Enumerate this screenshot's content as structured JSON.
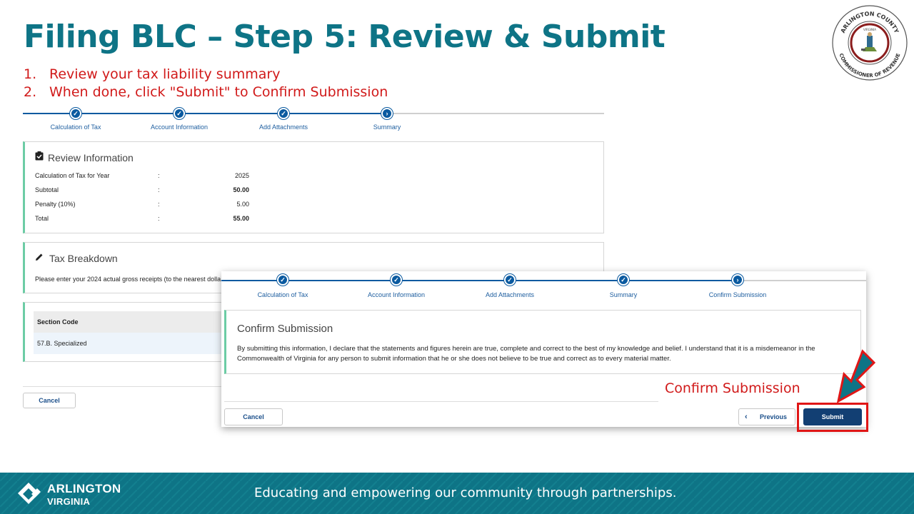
{
  "slide": {
    "title": "Filing BLC – Step 5:  Review & Submit",
    "instructions": [
      {
        "num": "1.",
        "text": "Review your tax liability summary"
      },
      {
        "num": "2.",
        "text": "When done, click \"Submit\" to Confirm Submission"
      }
    ],
    "callout": "Confirm Submission",
    "seal": {
      "top_text": "ARLINGTON COUNTY",
      "bottom_text": "COMMISSIONER OF REVENUE",
      "inner_text": "VIRGINIA"
    }
  },
  "background_stepper": {
    "steps": [
      {
        "label": "Calculation of Tax",
        "icon": "check-icon"
      },
      {
        "label": "Account Information",
        "icon": "check-icon"
      },
      {
        "label": "Add Attachments",
        "icon": "check-icon"
      },
      {
        "label": "Summary",
        "icon": "chevron-right-icon"
      }
    ]
  },
  "review": {
    "title": "Review Information",
    "rows": [
      {
        "label": "Calculation of Tax for Year",
        "sep": ":",
        "value": "2025"
      },
      {
        "label": "Subtotal",
        "sep": ":",
        "value": "50.00"
      },
      {
        "label": "Penalty (10%)",
        "sep": ":",
        "value": "5.00"
      },
      {
        "label": "Total",
        "sep": ":",
        "value": "55.00"
      }
    ]
  },
  "breakdown": {
    "title": "Tax Breakdown",
    "text": "Please enter your 2024 actual gross receipts (to the nearest dolla",
    "table": {
      "header": "Section Code",
      "row": "57.B. Specialized"
    }
  },
  "background_cancel": "Cancel",
  "modal": {
    "stepper": [
      {
        "label": "Calculation of Tax",
        "icon": "check-icon"
      },
      {
        "label": "Account Information",
        "icon": "check-icon"
      },
      {
        "label": "Add Attachments",
        "icon": "check-icon"
      },
      {
        "label": "Summary",
        "icon": "check-icon"
      },
      {
        "label": "Confirm Submission",
        "icon": "chevron-right-icon"
      }
    ],
    "title": "Confirm Submission",
    "text": "By submitting this information, I declare that the statements and figures herein are true, complete and correct to the best of my knowledge and belief. I understand that it is a misdemeanor in the Commonwealth of Virginia for any person to submit information that he or she does not believe to be true and correct as to every material matter.",
    "cancel": "Cancel",
    "previous": "Previous",
    "submit": "Submit"
  },
  "footer": {
    "logo_line1": "ARLINGTON",
    "logo_line2": "VIRGINIA",
    "tagline": "Educating and empowering our community through partnerships."
  },
  "colors": {
    "teal": "#0e7486",
    "red": "#d11a1a",
    "blue": "#0a5aa0",
    "navy_button": "#123f73",
    "green_accent": "#6ccca5"
  }
}
